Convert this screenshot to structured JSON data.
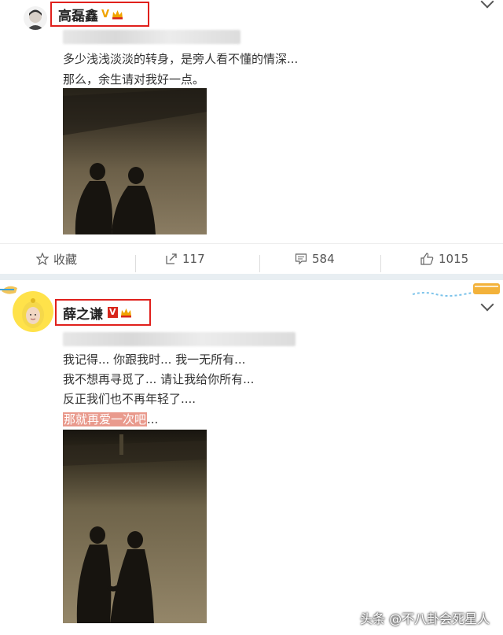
{
  "post1": {
    "username": "高磊鑫",
    "verified_badge": "V",
    "body_lines": [
      "多少浅浅淡淡的转身，是旁人看不懂的情深...",
      "那么，余生请对我好一点。"
    ],
    "actions": {
      "favorite_label": "收藏",
      "repost_count": "117",
      "comment_count": "584",
      "like_count": "1015"
    }
  },
  "post2": {
    "username": "薛之谦",
    "verified_badge": "V",
    "body_lines": [
      "我记得... 你跟我时... 我一无所有...",
      "我不想再寻觅了... 请让我给你所有...",
      "反正我们也不再年轻了...."
    ],
    "highlight_text": "那就再爱一次吧",
    "highlight_suffix": "..."
  },
  "watermark": "头条 @不八卦会死星人",
  "colors": {
    "highlight_border": "#e0201c",
    "highlight_text_bg": "#e99a8d",
    "verified_gold": "#f0a300",
    "verified_red": "#d8261b"
  },
  "icons": [
    "star-icon",
    "repost-icon",
    "comment-icon",
    "like-icon",
    "chevron-down-icon",
    "crown-icon"
  ]
}
